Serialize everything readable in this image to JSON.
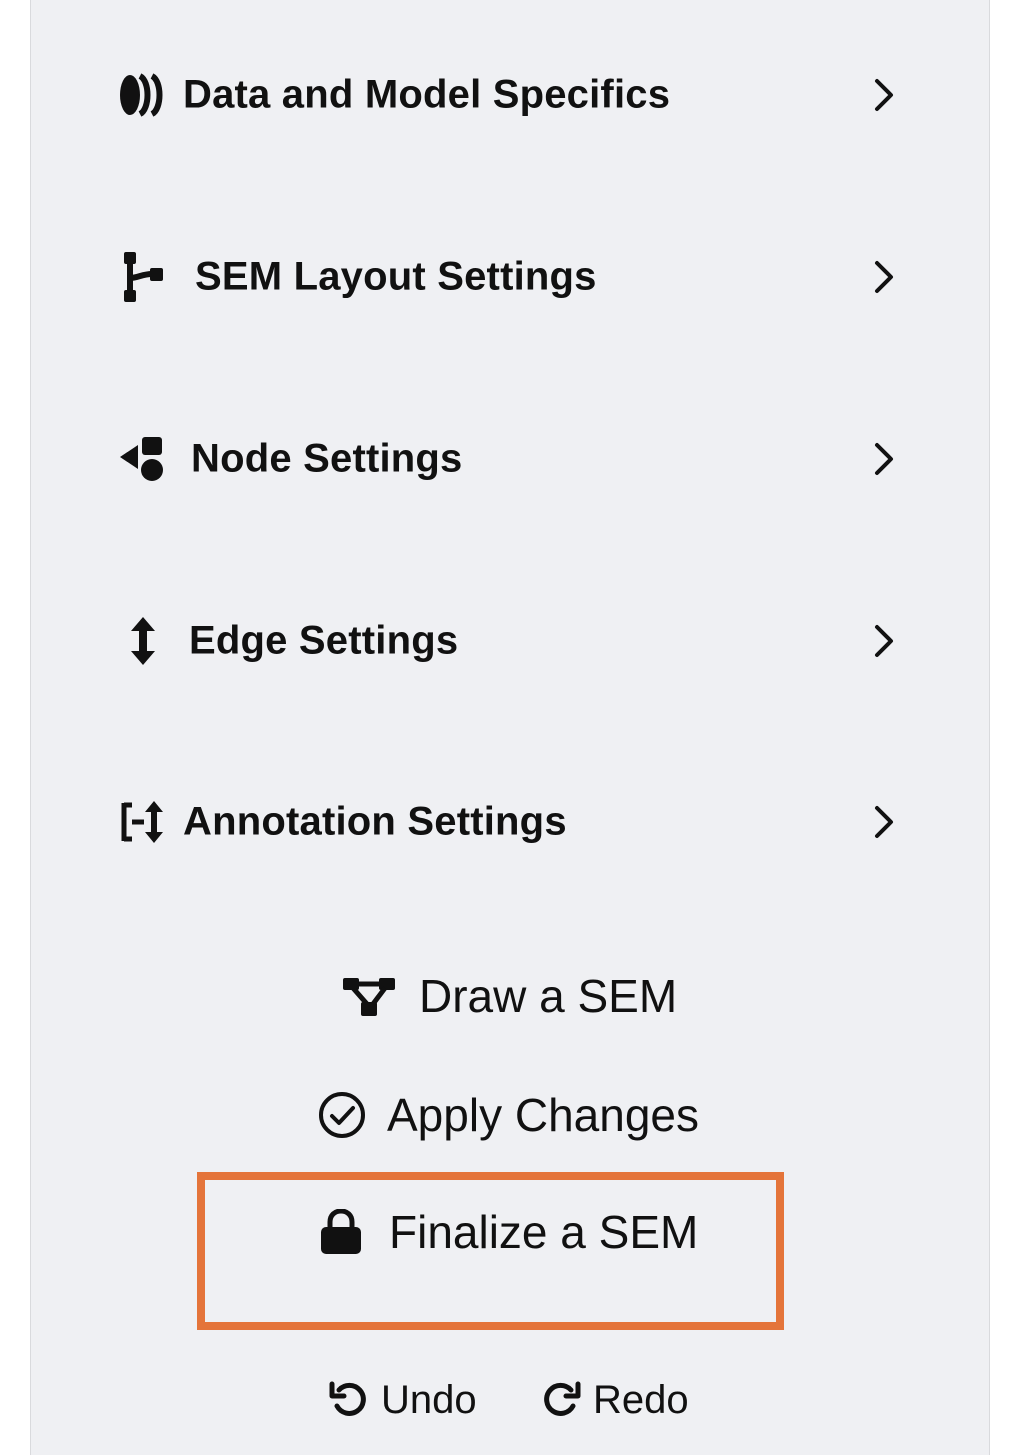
{
  "sidebar": {
    "sections": [
      {
        "label": "Data and Model Specifics",
        "icon": "database-icon"
      },
      {
        "label": "SEM Layout Settings",
        "icon": "diagram-project-icon"
      },
      {
        "label": "Node Settings",
        "icon": "shapes-icon"
      },
      {
        "label": "Edge Settings",
        "icon": "arrows-up-down-icon"
      },
      {
        "label": "Annotation Settings",
        "icon": "text-annotation-icon"
      }
    ],
    "actions": {
      "draw": {
        "label": "Draw a SEM",
        "icon": "network-icon"
      },
      "apply": {
        "label": "Apply Changes",
        "icon": "check-circle-icon"
      },
      "finalize": {
        "label": "Finalize a SEM",
        "icon": "lock-icon"
      },
      "undo": {
        "label": "Undo",
        "icon": "undo-icon"
      },
      "redo": {
        "label": "Redo",
        "icon": "redo-icon"
      }
    },
    "highlight_color": "#e4743a",
    "panel_color": "#eff0f3"
  }
}
